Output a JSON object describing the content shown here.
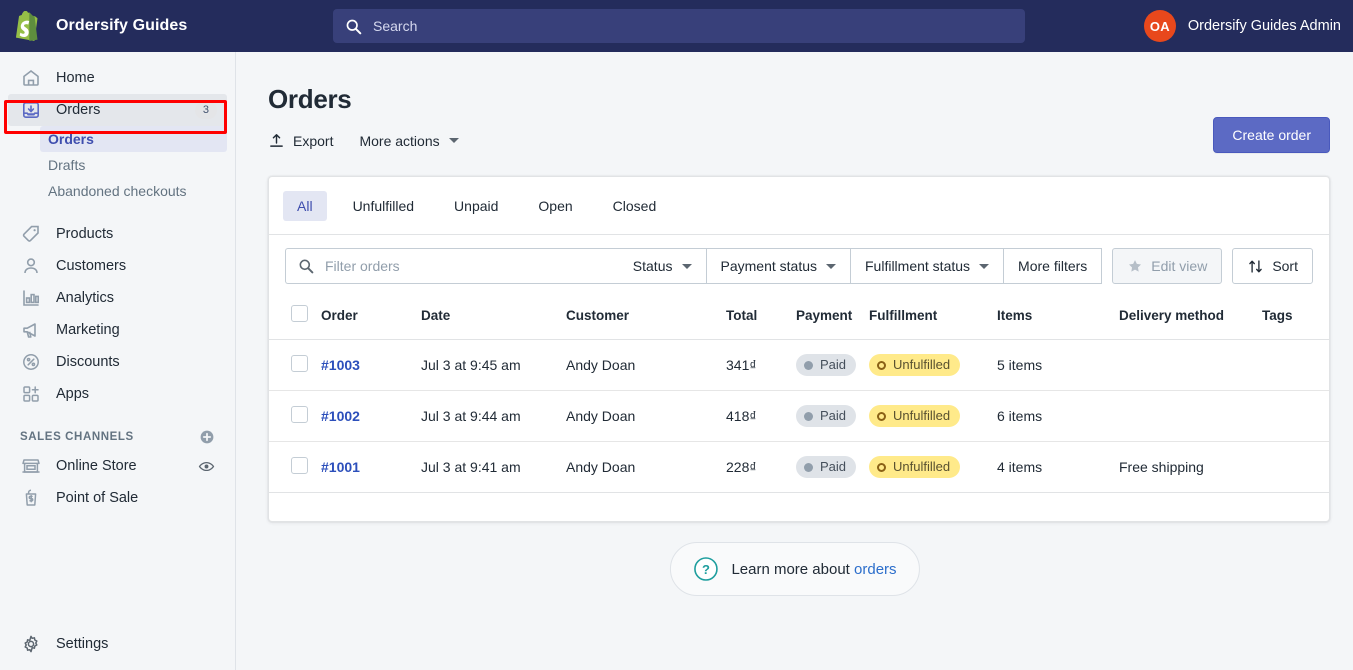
{
  "topbar": {
    "brand_name": "Ordersify Guides",
    "logo_icon": "shopify-bag-icon",
    "search": {
      "icon": "search-icon",
      "placeholder": "Search",
      "value": ""
    },
    "user": {
      "initials": "OA",
      "name": "Ordersify Guides Admin",
      "avatar_color": "#e8481c"
    }
  },
  "sidebar": {
    "items": [
      {
        "label": "Home",
        "icon": "home-icon"
      },
      {
        "label": "Orders",
        "icon": "orders-inbox-icon",
        "badge": "3",
        "highlighted": true
      },
      {
        "label": "Products",
        "icon": "tag-icon"
      },
      {
        "label": "Customers",
        "icon": "person-icon"
      },
      {
        "label": "Analytics",
        "icon": "bar-chart-icon"
      },
      {
        "label": "Marketing",
        "icon": "megaphone-icon"
      },
      {
        "label": "Discounts",
        "icon": "percent-badge-icon"
      },
      {
        "label": "Apps",
        "icon": "apps-grid-plus-icon"
      }
    ],
    "sub_items": [
      {
        "label": "Orders",
        "active": true
      },
      {
        "label": "Drafts",
        "active": false
      },
      {
        "label": "Abandoned checkouts",
        "active": false
      }
    ],
    "sales_channels": {
      "title": "SALES CHANNELS",
      "add_icon": "plus-circle-icon",
      "items": [
        {
          "label": "Online Store",
          "icon": "storefront-icon",
          "right_icon": "eye-icon"
        },
        {
          "label": "Point of Sale",
          "icon": "pos-bag-icon"
        }
      ]
    },
    "settings": {
      "label": "Settings",
      "icon": "gear-icon"
    },
    "highlight_color": "#ff0000"
  },
  "page": {
    "title": "Orders",
    "export": {
      "label": "Export",
      "icon": "export-upload-icon"
    },
    "more_actions": {
      "label": "More actions",
      "icon": "chevron-down-icon"
    },
    "create_order": {
      "label": "Create order",
      "color": "#5c6ac4"
    }
  },
  "tabs": [
    {
      "label": "All",
      "active": true
    },
    {
      "label": "Unfulfilled",
      "active": false
    },
    {
      "label": "Unpaid",
      "active": false
    },
    {
      "label": "Open",
      "active": false
    },
    {
      "label": "Closed",
      "active": false
    }
  ],
  "filters": {
    "search": {
      "icon": "search-icon",
      "placeholder": "Filter orders",
      "value": ""
    },
    "buttons": [
      {
        "label": "Status",
        "icon": "chevron-down-icon"
      },
      {
        "label": "Payment status",
        "icon": "chevron-down-icon"
      },
      {
        "label": "Fulfillment status",
        "icon": "chevron-down-icon"
      },
      {
        "label": "More filters",
        "icon": ""
      }
    ],
    "edit_view": {
      "label": "Edit view",
      "icon": "star-icon",
      "disabled": true
    },
    "sort": {
      "label": "Sort",
      "icon": "sort-arrows-icon"
    }
  },
  "table": {
    "columns": [
      "Order",
      "Date",
      "Customer",
      "Total",
      "Payment",
      "Fulfillment",
      "Items",
      "Delivery method",
      "Tags"
    ],
    "rows": [
      {
        "order": "#1003",
        "date": "Jul 3 at 9:45 am",
        "customer": "Andy Doan",
        "total": "341₫",
        "payment": "Paid",
        "fulfillment": "Unfulfilled",
        "items": "5 items",
        "delivery": "",
        "tags": ""
      },
      {
        "order": "#1002",
        "date": "Jul 3 at 9:44 am",
        "customer": "Andy Doan",
        "total": "418₫",
        "payment": "Paid",
        "fulfillment": "Unfulfilled",
        "items": "6 items",
        "delivery": "",
        "tags": ""
      },
      {
        "order": "#1001",
        "date": "Jul 3 at 9:41 am",
        "customer": "Andy Doan",
        "total": "228₫",
        "payment": "Paid",
        "fulfillment": "Unfulfilled",
        "items": "4 items",
        "delivery": "Free shipping",
        "tags": ""
      }
    ]
  },
  "help": {
    "icon": "question-circle-icon",
    "text": "Learn more about",
    "link": "orders"
  }
}
